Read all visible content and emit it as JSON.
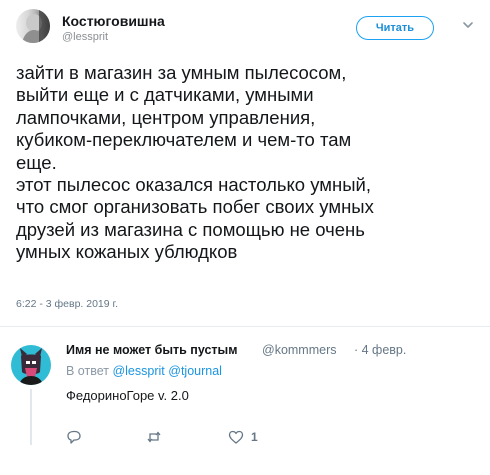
{
  "tweet": {
    "author_name": "Костюговишна",
    "author_handle": "@lessprit",
    "follow_label": "Читать",
    "text_lines": [
      "зайти в магазин за умным пылесосом,",
      "выйти еще и с датчиками, умными",
      "лампочками, центром управления,",
      "кубиком-переключателем и чем-то там",
      "еще.",
      "этот пылесос оказался настолько умный,",
      "что смог организовать побег своих умных",
      "друзей из магазина с помощью не очень",
      "умных кожаных ублюдков"
    ],
    "timestamp": "6:22 - 3 февр. 2019 г."
  },
  "reply": {
    "author_name": "Имя не может быть пустым",
    "author_handle": "@kommmers",
    "date": "· 4 февр.",
    "reply_to_prefix": "В ответ",
    "mentions": [
      "@lessprit",
      "@tjournal"
    ],
    "text": "ФедориноГоре v. 2.0",
    "actions": {
      "reply_count": "",
      "retweet_count": "",
      "like_count": "1"
    }
  },
  "icons": {
    "menu": "chevron-down-icon",
    "reply": "reply-bubble-icon",
    "retweet": "retweet-icon",
    "like": "heart-icon"
  },
  "colors": {
    "accent": "#1da1f2",
    "mention": "#1b95e0",
    "muted": "#657786",
    "text": "#14171a"
  }
}
